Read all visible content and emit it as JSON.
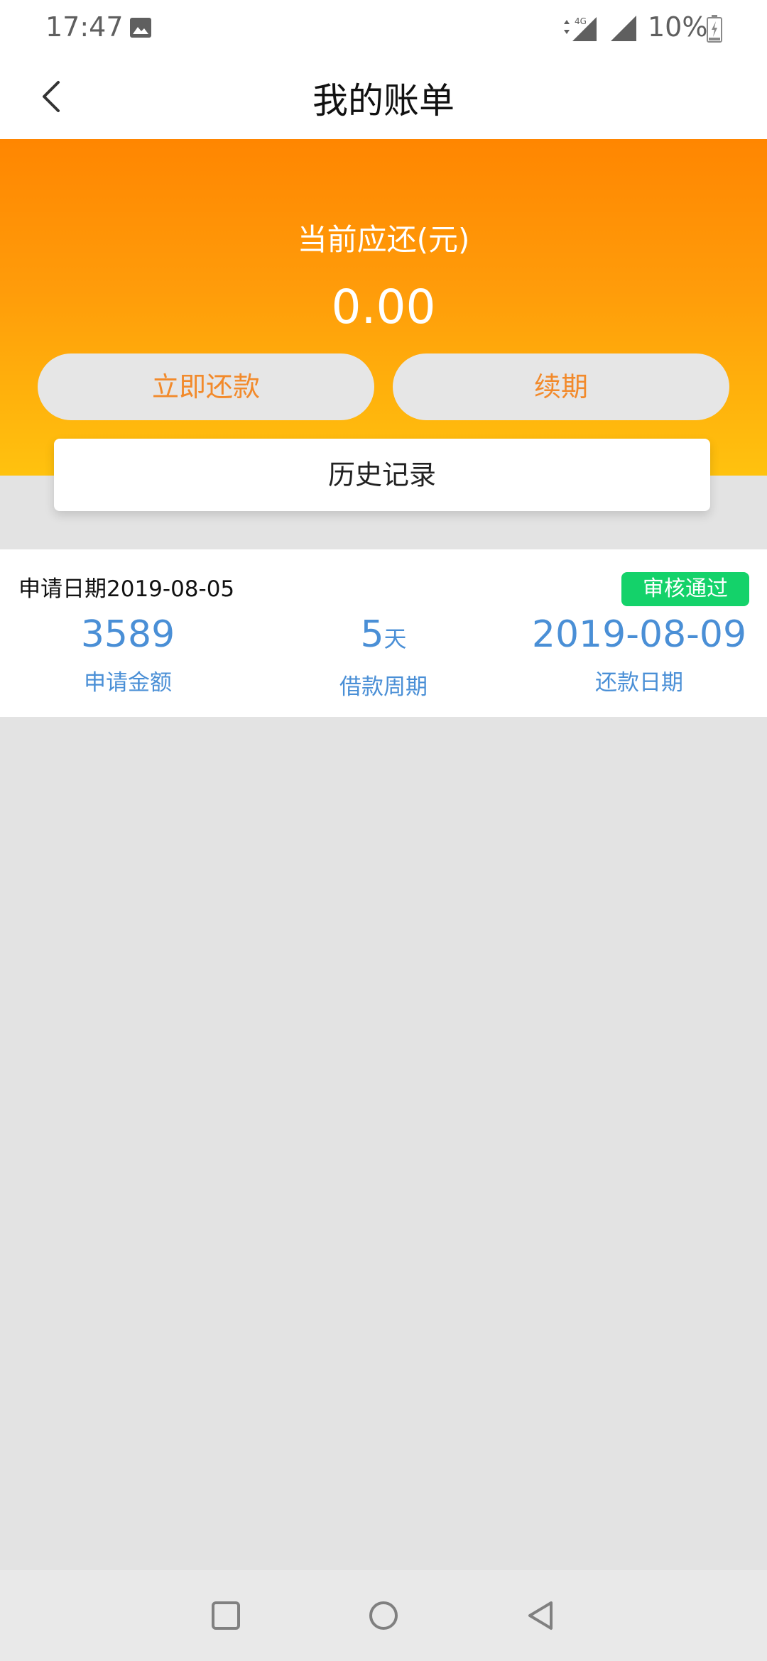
{
  "status_bar": {
    "time": "17:47",
    "battery": "10%",
    "network": "4G"
  },
  "header": {
    "title": "我的账单"
  },
  "summary": {
    "due_label": "当前应还(元)",
    "due_amount": "0.00",
    "repay_button": "立即还款",
    "renew_button": "续期",
    "history_button": "历史记录"
  },
  "record": {
    "apply_date": "申请日期2019-08-05",
    "status": "审核通过",
    "amount_value": "3589",
    "amount_label": "申请金额",
    "period_value": "5",
    "period_unit": "天",
    "period_label": "借款周期",
    "repay_date_value": "2019-08-09",
    "repay_date_label": "还款日期"
  },
  "colors": {
    "hero_gradient_top": "#ff8601",
    "hero_gradient_bottom": "#ffc20e",
    "button_text": "#f28a2b",
    "metric_text": "#4a8fd6",
    "status_badge": "#14d26a"
  },
  "icons": {
    "back": "chevron-left-icon",
    "photo": "image-icon",
    "recents": "square-icon",
    "home": "circle-icon",
    "nav_back": "triangle-back-icon"
  }
}
